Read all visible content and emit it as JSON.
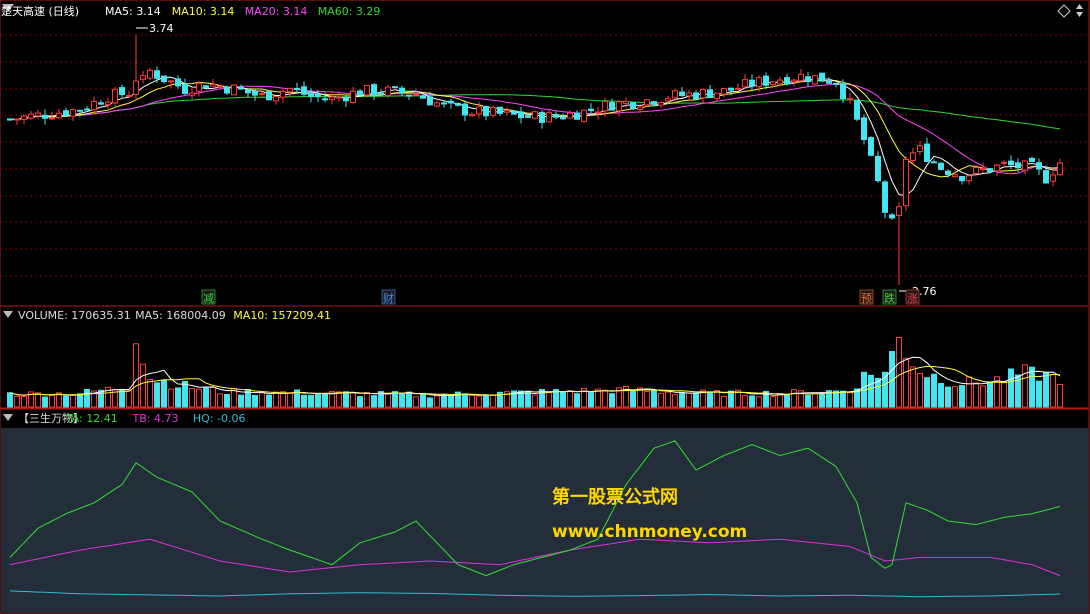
{
  "colors": {
    "background": "#000000",
    "panel_border": "#b01818",
    "grid": "#7a0000",
    "candle_up": "#ff3a3a",
    "candle_down": "#44e5ef",
    "ma5": "#ffffff",
    "ma10": "#ffff40",
    "ma20": "#ff44ff",
    "ma60": "#2ed82e",
    "indicator_bg": "#232e3a",
    "ta": "#33dd33",
    "tb": "#dd33dd",
    "hq": "#33bbcc",
    "watermark": "#ffd700"
  },
  "price_panel": {
    "title": "楚天高速 (日线)",
    "legend": [
      {
        "text": "MA5: 3.14",
        "color": "#ffffff"
      },
      {
        "text": "MA10: 3.14",
        "color": "#ffff40"
      },
      {
        "text": "MA20: 3.14",
        "color": "#ff44ff"
      },
      {
        "text": "MA60: 3.29",
        "color": "#2ed82e"
      }
    ],
    "high_label": "3.74",
    "low_label": "2.76",
    "diamond_icon": "diamond-outline-icon",
    "markers": [
      {
        "text": "减",
        "color": "#33dd33"
      },
      {
        "text": "财",
        "color": "#4a8ef5"
      },
      {
        "text": "预",
        "color": "#ff6a2a"
      },
      {
        "text": "跌",
        "color": "#33dd33"
      },
      {
        "text": "涨",
        "color": "#ff3a3a"
      }
    ]
  },
  "volume_panel": {
    "legend": [
      {
        "text": "VOLUME: 170635.31",
        "color": "#dddddd"
      },
      {
        "text": "MA5: 168004.09",
        "color": "#dddddd"
      },
      {
        "text": "MA10: 157209.41",
        "color": "#ffff40"
      }
    ]
  },
  "indicator_panel": {
    "legend": [
      {
        "text": "【三生万物】",
        "color": "#dddddd"
      },
      {
        "text": "TA: 12.41",
        "color": "#33dd33"
      },
      {
        "text": "TB: 4.73",
        "color": "#dd33dd"
      },
      {
        "text": "HQ: -0.06",
        "color": "#33bbcc"
      }
    ],
    "watermark_line1": "第一股票公式网",
    "watermark_line2": "www.chnmoney.com"
  },
  "chart_data": {
    "type": "candlestick",
    "price_axis_range": [
      2.7,
      3.8
    ],
    "price_anchors": [
      [
        0,
        3.41
      ],
      [
        5,
        3.43
      ],
      [
        10,
        3.45
      ],
      [
        14,
        3.5
      ],
      [
        18,
        3.52
      ],
      [
        20,
        3.6
      ],
      [
        22,
        3.57
      ],
      [
        25,
        3.53
      ],
      [
        28,
        3.55
      ],
      [
        32,
        3.53
      ],
      [
        36,
        3.5
      ],
      [
        40,
        3.53
      ],
      [
        43,
        3.5
      ],
      [
        46,
        3.49
      ],
      [
        50,
        3.52
      ],
      [
        54,
        3.52
      ],
      [
        58,
        3.51
      ],
      [
        62,
        3.46
      ],
      [
        66,
        3.44
      ],
      [
        70,
        3.43
      ],
      [
        74,
        3.42
      ],
      [
        78,
        3.42
      ],
      [
        82,
        3.44
      ],
      [
        86,
        3.47
      ],
      [
        90,
        3.48
      ],
      [
        94,
        3.5
      ],
      [
        98,
        3.51
      ],
      [
        102,
        3.52
      ],
      [
        106,
        3.55
      ],
      [
        110,
        3.57
      ],
      [
        113,
        3.58
      ],
      [
        116,
        3.57
      ],
      [
        118,
        3.56
      ],
      [
        120,
        3.47
      ],
      [
        122,
        3.33
      ],
      [
        124,
        3.16
      ],
      [
        125,
        3.05
      ],
      [
        126,
        3.0
      ],
      [
        127,
        3.05
      ],
      [
        128,
        3.26
      ],
      [
        130,
        3.29
      ],
      [
        133,
        3.22
      ],
      [
        136,
        3.19
      ],
      [
        139,
        3.21
      ],
      [
        142,
        3.23
      ],
      [
        146,
        3.22
      ],
      [
        148,
        3.18
      ],
      [
        150,
        3.24
      ]
    ],
    "volume_axis_range": [
      0,
      500000
    ],
    "volume_anchors": [
      [
        0,
        75000
      ],
      [
        10,
        80000
      ],
      [
        17,
        120000
      ],
      [
        18,
        460000
      ],
      [
        19,
        300000
      ],
      [
        20,
        170000
      ],
      [
        24,
        130000
      ],
      [
        30,
        90000
      ],
      [
        60,
        70000
      ],
      [
        88,
        100000
      ],
      [
        100,
        80000
      ],
      [
        110,
        80000
      ],
      [
        120,
        95000
      ],
      [
        122,
        180000
      ],
      [
        125,
        200000
      ],
      [
        126,
        300000
      ],
      [
        127,
        400000
      ],
      [
        128,
        330000
      ],
      [
        130,
        210000
      ],
      [
        135,
        140000
      ],
      [
        140,
        150000
      ],
      [
        145,
        200000
      ],
      [
        150,
        170000
      ]
    ],
    "indicator_axis_range": [
      -5,
      45
    ],
    "TA_anchors": [
      [
        0,
        10
      ],
      [
        4,
        18
      ],
      [
        8,
        22
      ],
      [
        12,
        25
      ],
      [
        16,
        30
      ],
      [
        18,
        36
      ],
      [
        21,
        32
      ],
      [
        26,
        28
      ],
      [
        30,
        20
      ],
      [
        36,
        15
      ],
      [
        40,
        12
      ],
      [
        46,
        8
      ],
      [
        50,
        14
      ],
      [
        55,
        17
      ],
      [
        58,
        20
      ],
      [
        61,
        14
      ],
      [
        64,
        8
      ],
      [
        68,
        5
      ],
      [
        72,
        8
      ],
      [
        76,
        10
      ],
      [
        80,
        12
      ],
      [
        84,
        15
      ],
      [
        88,
        30
      ],
      [
        92,
        40
      ],
      [
        95,
        42
      ],
      [
        98,
        34
      ],
      [
        102,
        38
      ],
      [
        106,
        41
      ],
      [
        110,
        38
      ],
      [
        114,
        40
      ],
      [
        118,
        35
      ],
      [
        121,
        25
      ],
      [
        123,
        10
      ],
      [
        125,
        7
      ],
      [
        126,
        8
      ],
      [
        128,
        25
      ],
      [
        131,
        23
      ],
      [
        134,
        20
      ],
      [
        138,
        19
      ],
      [
        142,
        21
      ],
      [
        146,
        22
      ],
      [
        150,
        24
      ]
    ],
    "TB_anchors": [
      [
        0,
        8
      ],
      [
        10,
        12
      ],
      [
        20,
        15
      ],
      [
        30,
        9
      ],
      [
        40,
        6
      ],
      [
        50,
        8
      ],
      [
        60,
        9
      ],
      [
        70,
        8
      ],
      [
        80,
        12
      ],
      [
        90,
        15
      ],
      [
        100,
        14
      ],
      [
        110,
        15
      ],
      [
        120,
        13
      ],
      [
        125,
        9
      ],
      [
        130,
        10
      ],
      [
        140,
        10
      ],
      [
        146,
        8
      ],
      [
        150,
        5
      ]
    ],
    "HQ_anchors": [
      [
        0,
        0.8
      ],
      [
        10,
        0.0
      ],
      [
        20,
        -0.3
      ],
      [
        30,
        -0.6
      ],
      [
        40,
        0.0
      ],
      [
        50,
        0.3
      ],
      [
        60,
        0.1
      ],
      [
        70,
        -0.4
      ],
      [
        80,
        -0.7
      ],
      [
        90,
        -0.5
      ],
      [
        100,
        -0.2
      ],
      [
        110,
        -0.6
      ],
      [
        120,
        -0.4
      ],
      [
        130,
        -0.8
      ],
      [
        140,
        -0.6
      ],
      [
        150,
        -0.06
      ]
    ]
  }
}
